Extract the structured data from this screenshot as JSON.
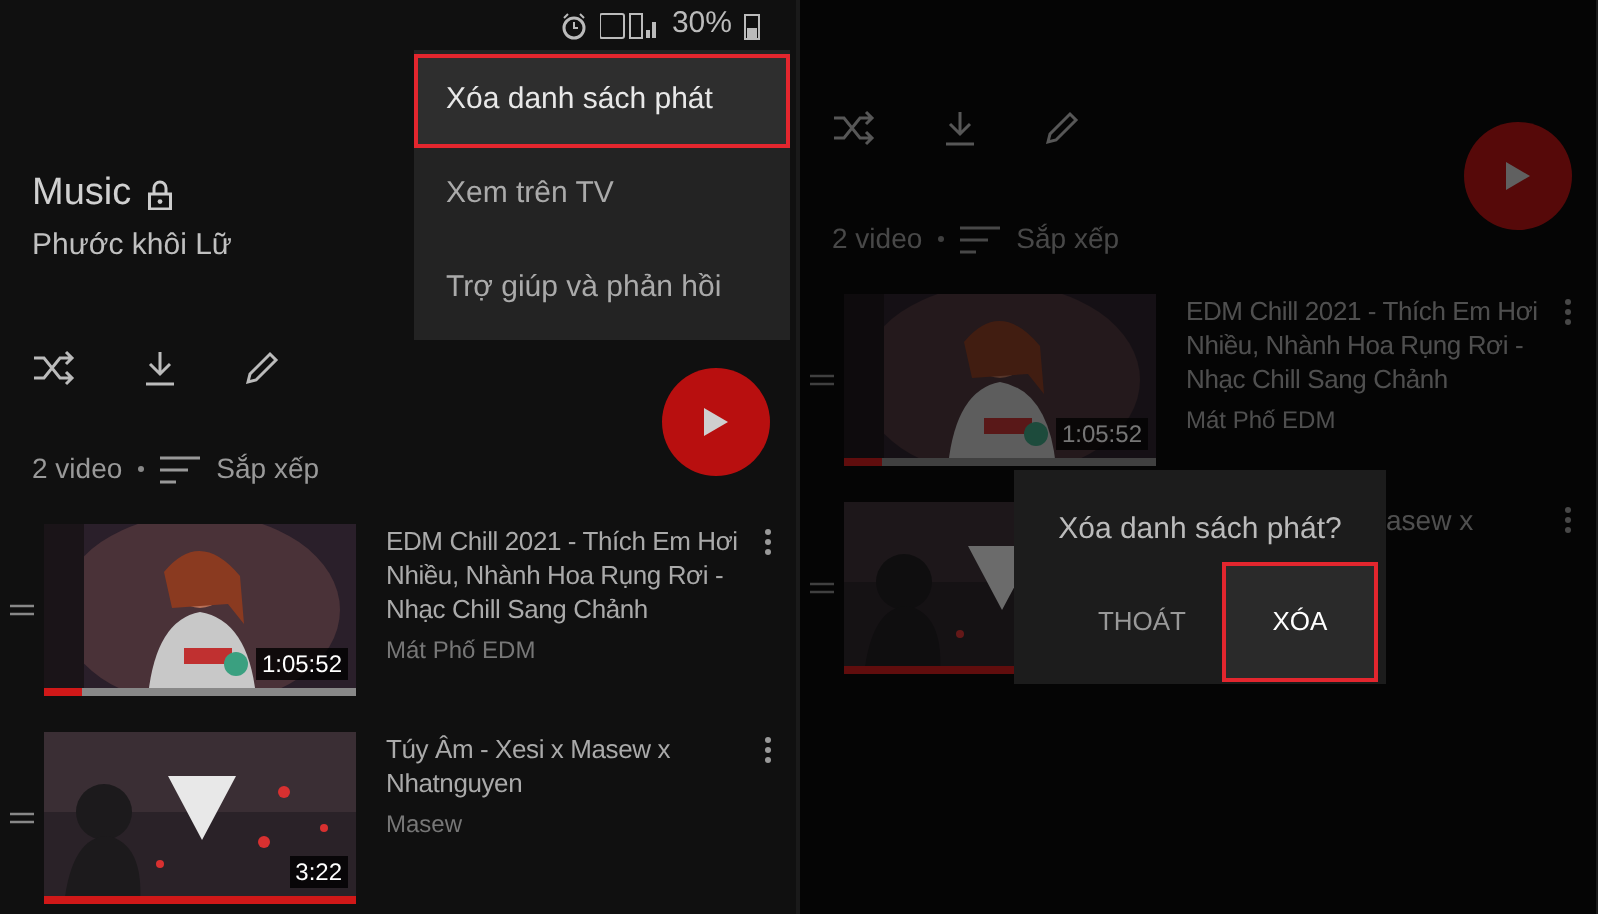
{
  "screens": [
    {
      "status_bar": {
        "battery": "30%"
      },
      "playlist": {
        "title": "Music",
        "owner": "Phước khôi Lữ",
        "private": true
      },
      "video_count": "2 video",
      "sort_label": "Sắp xếp",
      "videos": [
        {
          "title": "EDM Chill 2021 - Thích Em Hơi Nhiều, Nhành Hoa Rụng Rơi - Nhạc Chill Sang Chảnh",
          "channel": "Mát Phố EDM",
          "duration": "1:05:52",
          "level": 0.12
        },
        {
          "title": "Túy Âm - Xesi x Masew x Nhatnguyen",
          "channel": "Masew",
          "duration": "3:22",
          "level": 1
        }
      ],
      "menu": [
        {
          "label": "Xóa danh sách phát",
          "highlighted": true
        },
        {
          "label": "Xem trên TV",
          "highlighted": false
        },
        {
          "label": "Trợ giúp và phản hồi",
          "highlighted": false
        }
      ]
    },
    {
      "video_count": "2 video",
      "sort_label": "Sắp xếp",
      "videos": [
        {
          "title": "EDM Chill 2021 - Thích Em Hơi Nhiều, Nhành Hoa Rụng Rơi - Nhạc Chill Sang Chảnh",
          "channel": "Mát Phố EDM",
          "duration": "1:05:52",
          "level": 0.12
        },
        {
          "title": "asew x",
          "level": 1
        }
      ],
      "dialog": {
        "title": "Xóa danh sách phát?",
        "buttons": [
          {
            "label": "THOÁT",
            "highlighted": false
          },
          {
            "label": "XÓA",
            "highlighted": true
          }
        ]
      }
    }
  ]
}
